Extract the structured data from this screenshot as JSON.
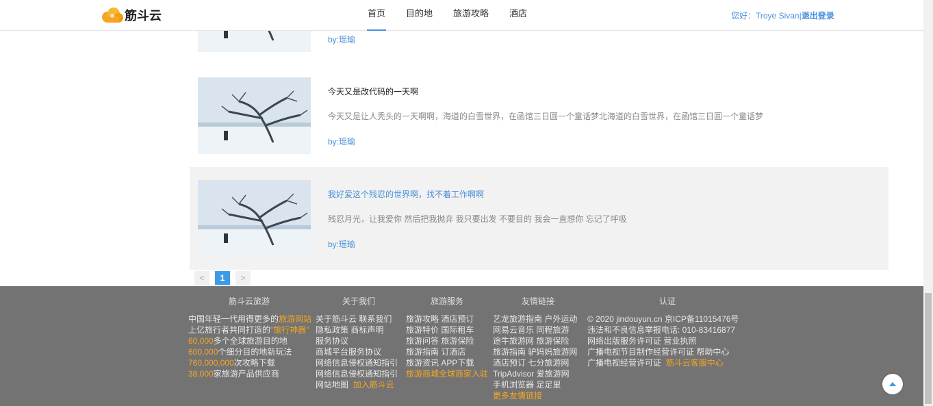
{
  "brand": {
    "name": "筋斗云"
  },
  "nav": {
    "items": [
      {
        "label": "首页",
        "active": true
      },
      {
        "label": "目的地",
        "active": false
      },
      {
        "label": "旅游攻略",
        "active": false
      },
      {
        "label": "酒店",
        "active": false
      }
    ]
  },
  "user": {
    "greeting": "您好：Troye Sivan",
    "separator": "|",
    "logout": "退出登录"
  },
  "articles": [
    {
      "title": "",
      "desc": "",
      "author_prefix": "by:",
      "author": "瑶瑜"
    },
    {
      "title": "今天又是改代码的一天啊",
      "desc": "今天又是让人秃头的一天啊啊，海道的白雪世界，在函馆三日圆一个童话梦北海道的白雪世界，在函馆三日圆一个童话梦",
      "author_prefix": "by:",
      "author": "瑶瑜"
    },
    {
      "title": "我好爱这个残忍的世界啊，找不着工作啊啊",
      "desc": "残忍月光，让我爱你 然后把我抛弃 我只要出发 不要目的 我会一直想你 忘记了呼吸",
      "author_prefix": "by:",
      "author": "瑶瑜"
    }
  ],
  "pagination": {
    "prev": "<",
    "current": "1",
    "next": ">"
  },
  "footer": {
    "col1": {
      "heading": "筋斗云旅游",
      "l1a": "中国年轻一代用得更多的",
      "l1b": "旅游网站",
      "l2a": "上亿旅行者共同打造的",
      "l2b": "\"旅行神器\"",
      "l3a": "60,000",
      "l3b": "多个全球旅游目的地",
      "l4a": "600,000",
      "l4b": "个细分目的地新玩法",
      "l5a": "760,000,000",
      "l5b": "次攻略下载",
      "l6a": "38,000",
      "l6b": "家旅游产品供应商"
    },
    "col2": {
      "heading": "关于我们",
      "l1": "关于筋斗云  联系我们",
      "l2": "隐私政策  商标声明",
      "l3": "服务协议",
      "l4": "商城平台服务协议",
      "l5": "网络信息侵权通知指引",
      "l6": "网络信息侵权通知指引",
      "l7a": "网站地图",
      "l7b": "加入筋斗云"
    },
    "col3": {
      "heading": "旅游服务",
      "l1": "旅游攻略  酒店预订",
      "l2": "旅游特价  国际租车",
      "l3": "旅游问答  旅游保险",
      "l4": "旅游指南  订酒店",
      "l5": "旅游资讯  APP下载",
      "l6": "旅游商城全球商家入驻"
    },
    "col4": {
      "heading": "友情链接",
      "l1": "艺龙旅游指南  户外运动",
      "l2": "网易云音乐  同程旅游",
      "l3": "途牛旅游网  旅游保险",
      "l4": "旅游指南  驴妈妈旅游网",
      "l5": "酒店预订  七分旅游网",
      "l6": "TripAdvisor  爱旅游网",
      "l7": "手机浏览器  足足里",
      "l8": "更多友情链接"
    },
    "col5": {
      "heading": "认证",
      "l1": "© 2020 jindouyun.cn   京ICP备11015476号",
      "l2": "违法和不良信息举报电话: 010-83416877",
      "l3": "网络出版服务许可证  营业执照",
      "l4": "广播电视节目制作经营许可证  帮助中心",
      "l5a": "广播电视经营许可证",
      "l5b": "筋斗云客服中心"
    }
  },
  "colors": {
    "accent": "#4a90d9",
    "orange": "#f5a623",
    "footer_bg": "#737373"
  },
  "icons": {
    "logo": "cloud-logo-icon",
    "to_top": "arrow-up-icon"
  }
}
